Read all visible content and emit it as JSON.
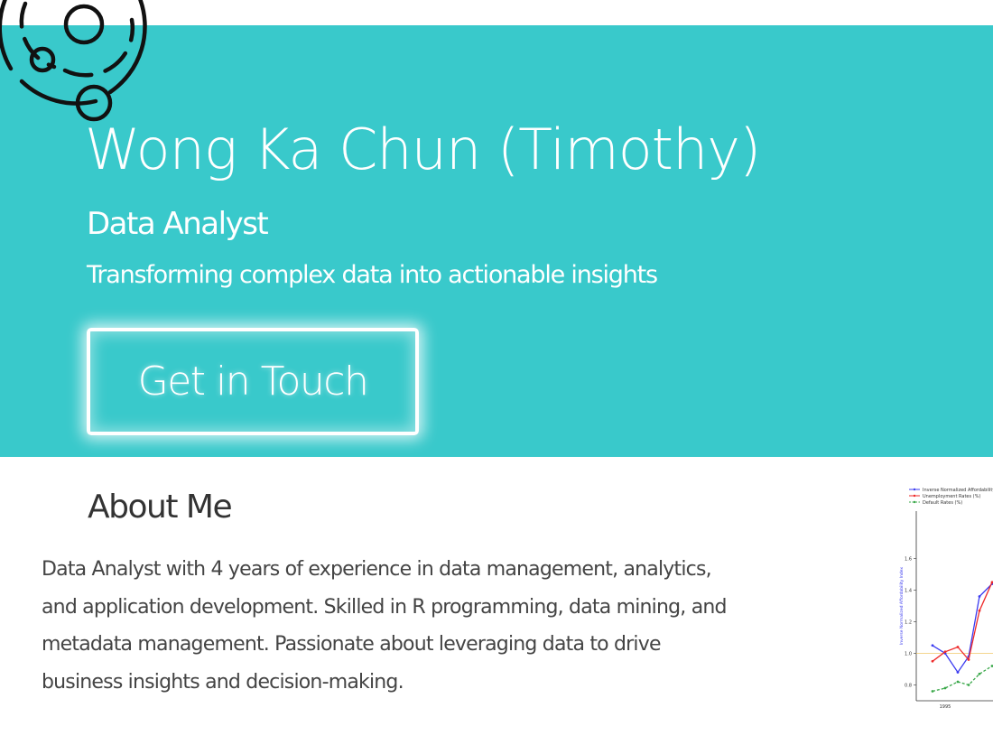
{
  "hero": {
    "name": "Wong Ka Chun (Timothy)",
    "role": "Data Analyst",
    "tagline": "Transforming complex data into actionable insights",
    "cta_label": "Get in Touch",
    "background_color": "#39c9cb",
    "logo_icon": "orbit-circles-logo"
  },
  "about": {
    "heading": "About Me",
    "body": "Data Analyst with 4 years of experience in data management, analytics, and application development. Skilled in R programming, data mining, and metadata management. Passionate about leveraging data to drive business insights and decision-making."
  },
  "chart_data": {
    "type": "line",
    "ylabel": "Inverse Normalized Affordability Index",
    "ylim": [
      0.7,
      1.9
    ],
    "y_ticks": [
      "0.8",
      "1.0",
      "1.2",
      "1.4",
      "1.6"
    ],
    "x_ticks": [
      "1995"
    ],
    "reference_line": 1.0,
    "legend_placement": "top-left",
    "series": [
      {
        "name": "Inverse Normalized Affordability Index",
        "color": "#3b3bf0",
        "style": "solid",
        "marker": "dot",
        "values": [
          1.05,
          1.0,
          0.88,
          0.98,
          1.36,
          1.44
        ]
      },
      {
        "name": "Unemployment Rates (%)",
        "color": "#ee2a2a",
        "style": "solid",
        "marker": "dot",
        "values": [
          0.95,
          1.01,
          1.04,
          0.96,
          1.27,
          1.45
        ]
      },
      {
        "name": "Default Rates (%)",
        "color": "#3aa84a",
        "style": "dashed",
        "marker": "dot",
        "values": [
          0.76,
          0.78,
          0.82,
          0.8,
          0.87,
          0.92
        ]
      }
    ]
  }
}
